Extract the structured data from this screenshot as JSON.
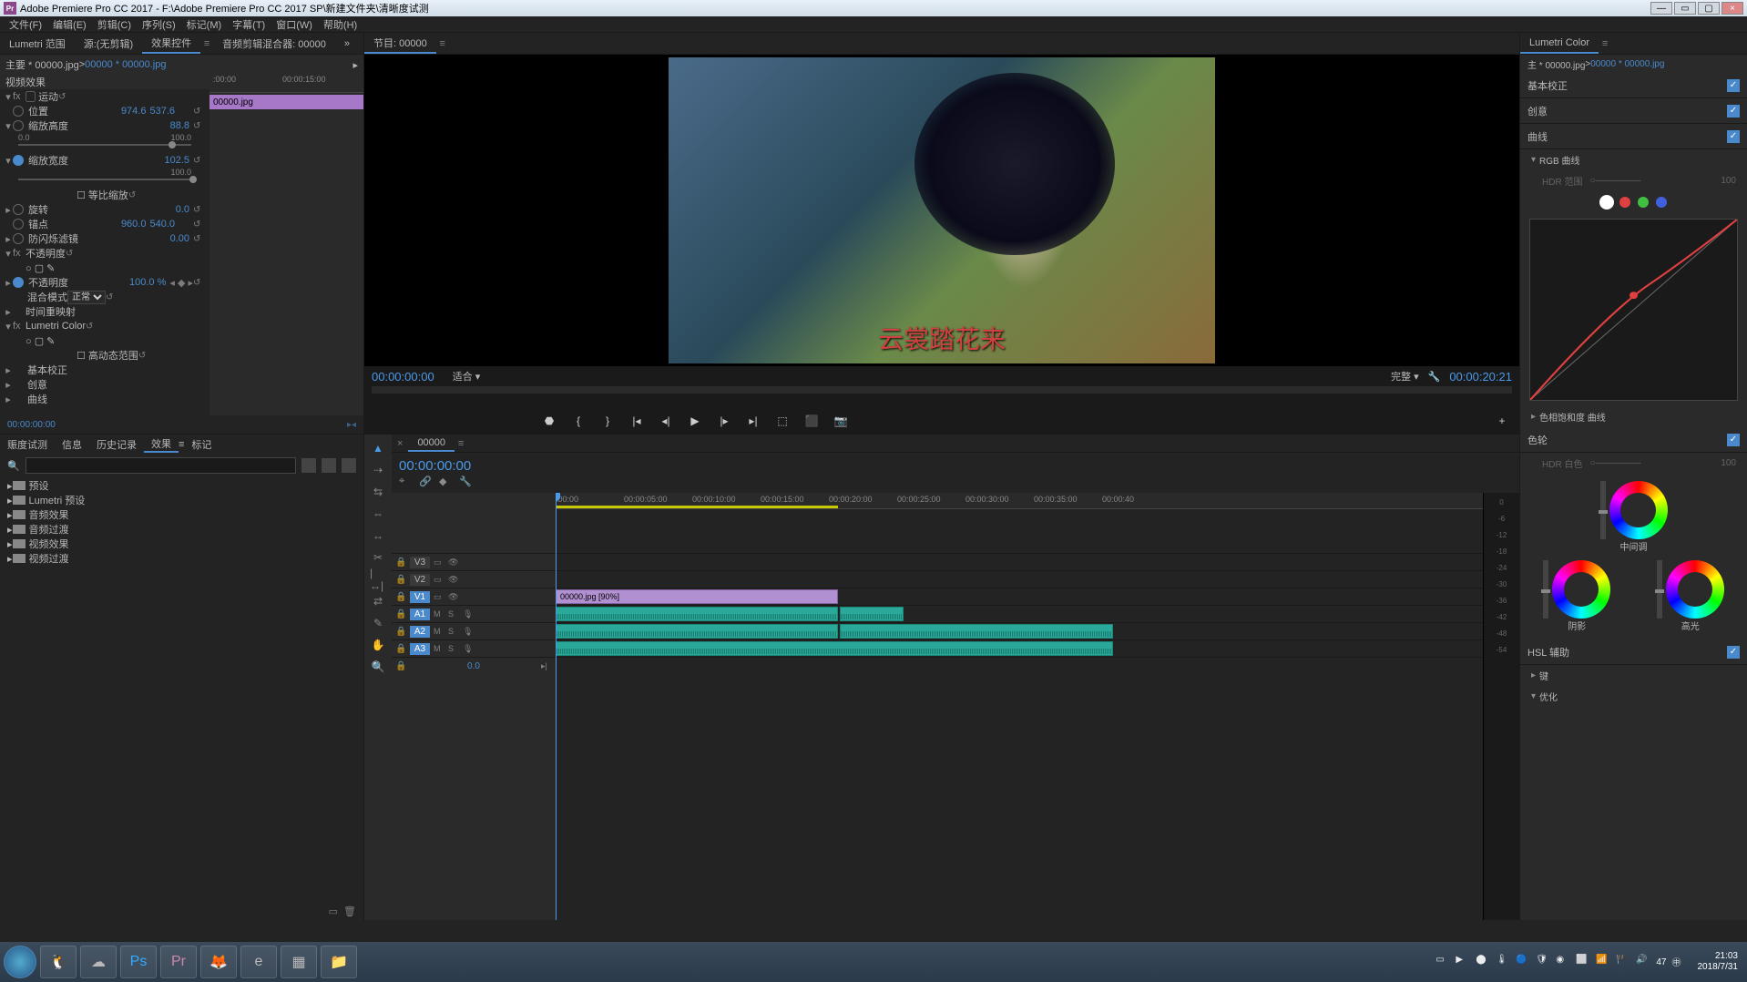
{
  "app": {
    "title": "Adobe Premiere Pro CC 2017 - F:\\Adobe Premiere Pro CC 2017 SP\\新建文件夹\\清晰度试测",
    "icon_label": "Pr"
  },
  "menu": [
    "文件(F)",
    "编辑(E)",
    "剪辑(C)",
    "序列(S)",
    "标记(M)",
    "字幕(T)",
    "窗口(W)",
    "帮助(H)"
  ],
  "source_tabs": {
    "scope": "Lumetri 范围",
    "source": "源:(无剪辑)",
    "effect_controls": "效果控件",
    "audio_mixer": "音频剪辑混合器: 00000",
    "chevron": "»"
  },
  "effect_controls": {
    "master": "主要 * 00000.jpg",
    "link_sep": " > ",
    "clip_link": "00000 * 00000.jpg",
    "timeruler_start": ":00:00",
    "timeruler_mid": "00:00:15:00",
    "clip_name": "00000.jpg",
    "section_video": "视频效果",
    "motion": "运动",
    "position": "位置",
    "position_x": "974.6",
    "position_y": "537.6",
    "scale_h": "缩放高度",
    "scale_h_val": "88.8",
    "scale_w": "缩放宽度",
    "scale_w_val": "102.5",
    "uniform": "等比缩放",
    "rotation": "旋转",
    "rotation_val": "0.0",
    "anchor": "锚点",
    "anchor_x": "960.0",
    "anchor_y": "540.0",
    "antiflicker": "防闪烁滤镜",
    "antiflicker_val": "0.00",
    "opacity": "不透明度",
    "opacity_prop": "不透明度",
    "opacity_val": "100.0 %",
    "blend": "混合模式",
    "blend_val": "正常",
    "time_remap": "时间重映射",
    "lumetri": "Lumetri Color",
    "hdr_range": "高动态范围",
    "basic": "基本校正",
    "creative": "创意",
    "curves": "曲线",
    "slider_min": "0.0",
    "slider_max": "100.0",
    "footer_tc": "00:00:00:00"
  },
  "effects_panel": {
    "tabs": [
      "赈度试测",
      "信息",
      "历史记录",
      "效果",
      "标记"
    ],
    "active_tab": 3,
    "search_placeholder": "",
    "folders": [
      "预设",
      "Lumetri 预设",
      "音频效果",
      "音频过渡",
      "视频效果",
      "视频过渡"
    ]
  },
  "program": {
    "header": "节目: 00000",
    "caption": "云裳踏花来",
    "tc_left": "00:00:00:00",
    "fit": "适合",
    "quality": "完整",
    "tc_right": "00:00:20:21"
  },
  "timeline": {
    "seq_name": "00000",
    "tc": "00:00:00:00",
    "ticks": [
      ":00:00",
      "00:00:05:00",
      "00:00:10:00",
      "00:00:15:00",
      "00:00:20:00",
      "00:00:25:00",
      "00:00:30:00",
      "00:00:35:00",
      "00:00:40"
    ],
    "tracks_v": [
      "V3",
      "V2",
      "V1"
    ],
    "tracks_a": [
      "A1",
      "A2",
      "A3"
    ],
    "clip_v1": "00000.jpg [90%]",
    "mute": "M",
    "solo": "S",
    "zero": "0.0"
  },
  "lumetri": {
    "title": "Lumetri Color",
    "master": "主 * 00000.jpg",
    "link_sep": " > ",
    "clip_link": "00000 * 00000.jpg",
    "basic": "基本校正",
    "creative": "创意",
    "curves": "曲线",
    "rgb_curves": "RGB 曲线",
    "hdr_range": "HDR 范围",
    "hdr_val": "100",
    "hue_sat": "色相饱和度 曲线",
    "wheels": "色轮",
    "hdr_white": "HDR 白色",
    "hdr_white_val": "100",
    "midtones": "中间调",
    "shadows": "阴影",
    "highlights": "高光",
    "hsl": "HSL 辅助",
    "key": "键",
    "vignette": "优化"
  },
  "meters": [
    "0",
    "-6",
    "-12",
    "-18",
    "-24",
    "-30",
    "-36",
    "-42",
    "-48",
    "-54"
  ],
  "taskbar": {
    "time": "21:03",
    "date": "2018/7/31",
    "vol": "47"
  }
}
